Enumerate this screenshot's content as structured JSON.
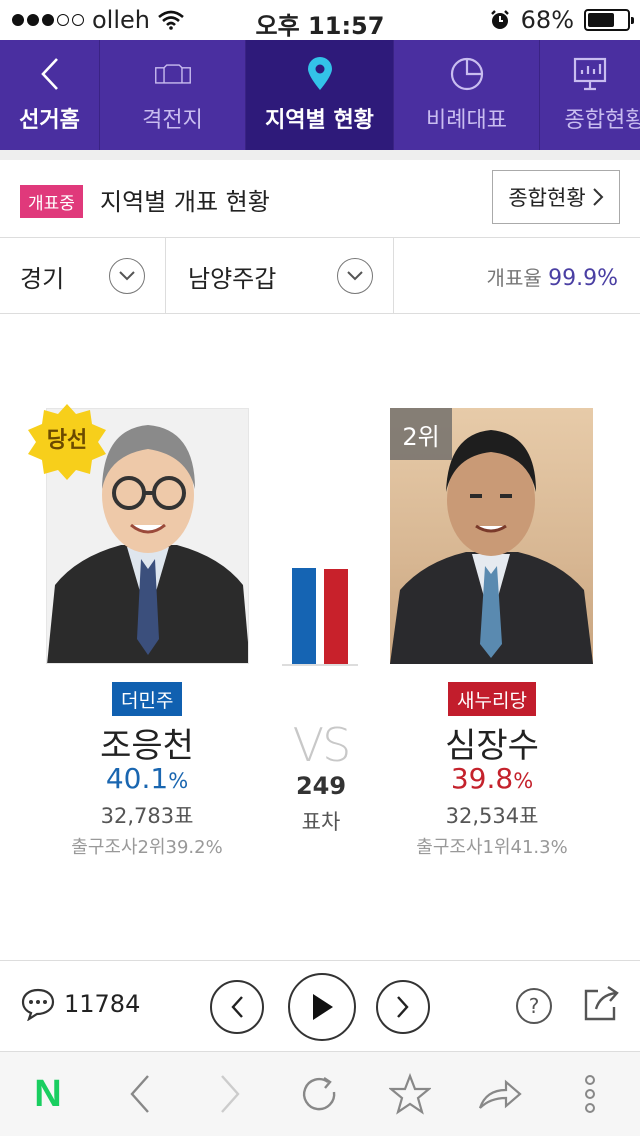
{
  "status_bar": {
    "carrier": "olleh",
    "time": "오후 11:57",
    "battery": "68%",
    "battery_level": 0.68
  },
  "nav": {
    "tabs": [
      {
        "label": "선거홈",
        "icon": "chevron-left-icon"
      },
      {
        "label": "격전지",
        "icon": "ballot-box-icon"
      },
      {
        "label": "지역별 현황",
        "icon": "map-pin-icon"
      },
      {
        "label": "비례대표",
        "icon": "pie-chart-icon"
      },
      {
        "label": "종합현황",
        "icon": "presentation-chart-icon"
      }
    ],
    "active_index": 2
  },
  "header": {
    "status_badge": "개표중",
    "title": "지역별 개표 현황",
    "summary_button": "종합현황"
  },
  "filters": {
    "region": "경기",
    "district": "남양주갑",
    "count_rate_label": "개표율",
    "count_rate": "99.9%"
  },
  "candidates": [
    {
      "status": "당선",
      "party": "더민주",
      "party_color": "#1060b0",
      "name": "조응천",
      "percent": "40.1",
      "percent_unit": "%",
      "votes": "32,783표",
      "exit_poll": "출구조사2위39.2%",
      "share": 40.1
    },
    {
      "status": "2위",
      "party": "새누리당",
      "party_color": "#c21d2c",
      "name": "심장수",
      "percent": "39.8",
      "percent_unit": "%",
      "votes": "32,534표",
      "exit_poll": "출구조사1위41.3%",
      "share": 39.8
    }
  ],
  "versus": {
    "vs_text": "VS",
    "vote_gap": "249",
    "vote_gap_label": "표차"
  },
  "controls": {
    "comment_count": "11784"
  },
  "browser": {
    "logo": "N"
  }
}
